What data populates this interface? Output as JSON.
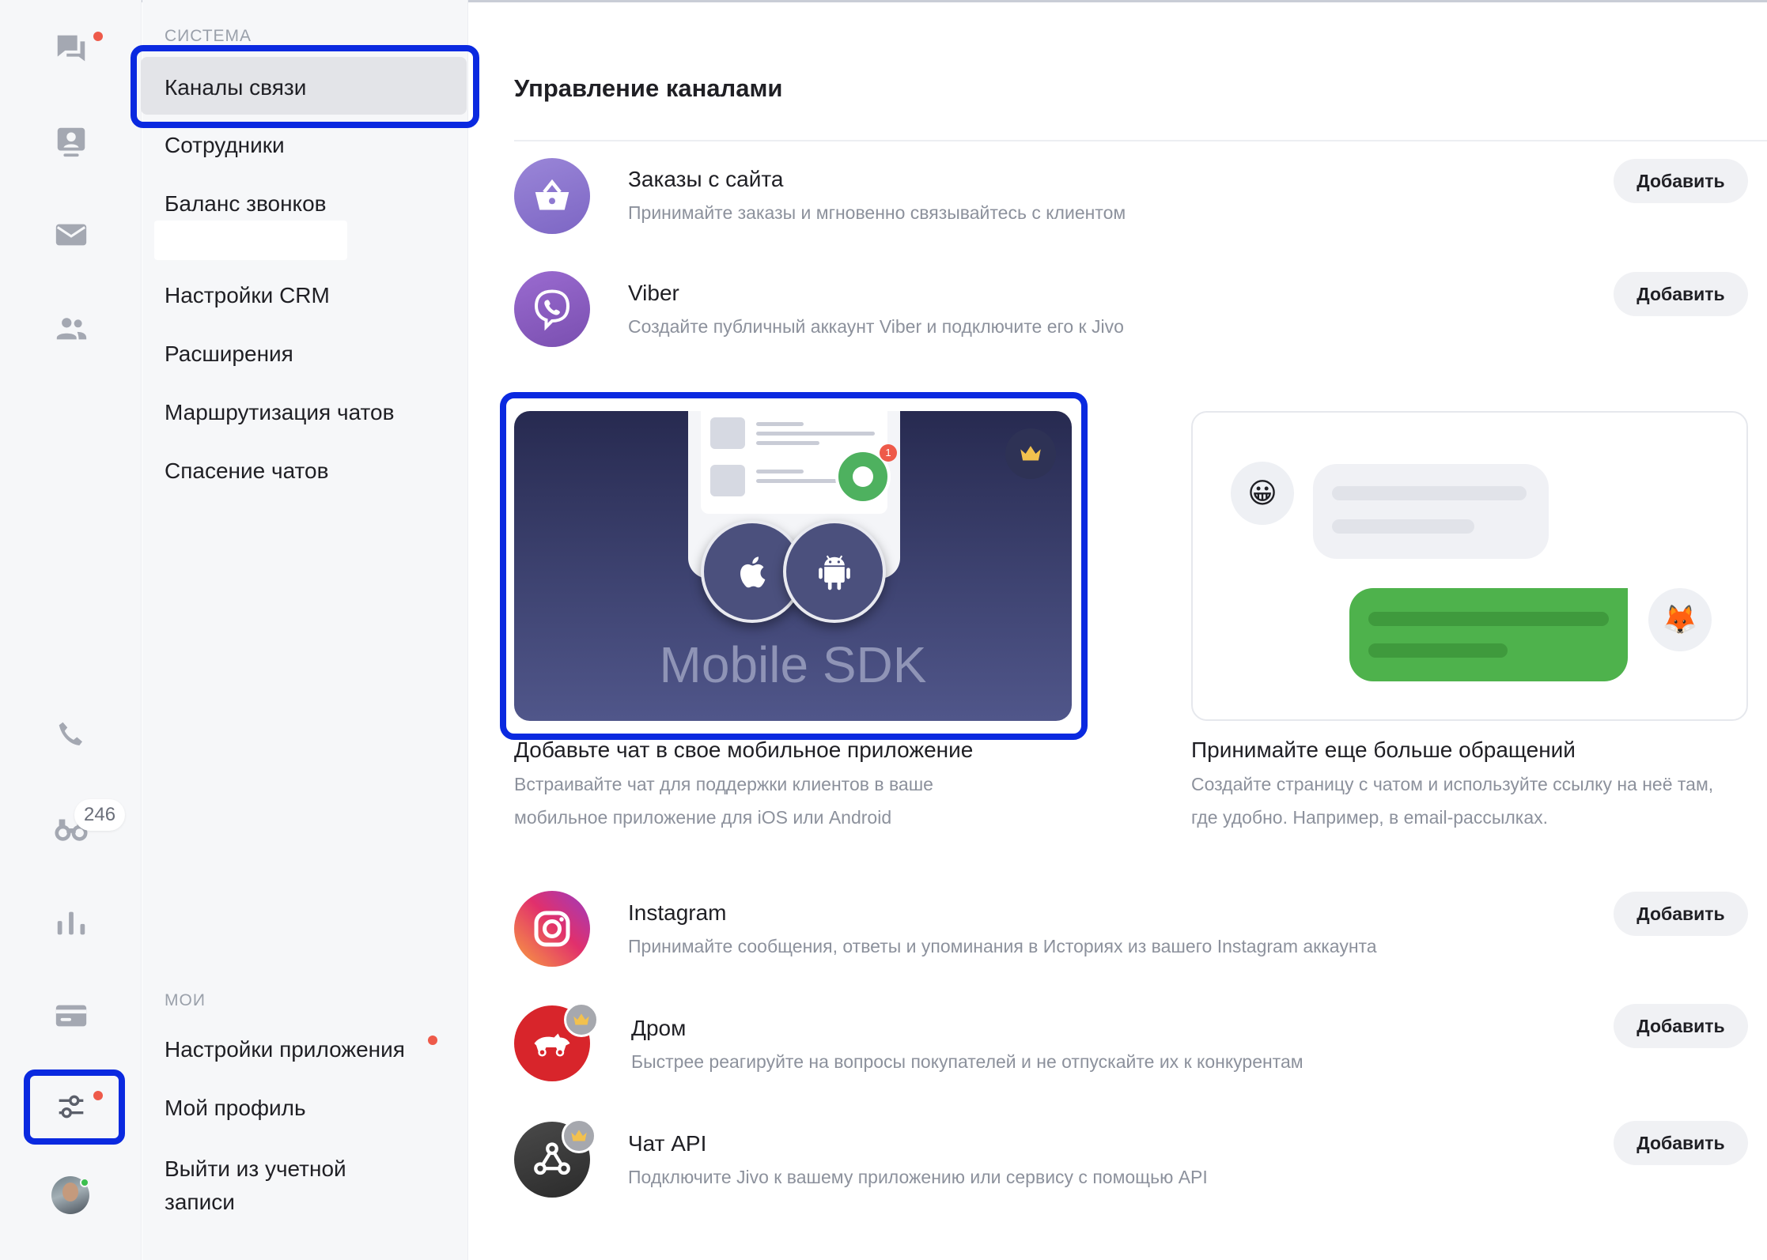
{
  "rail": {
    "badge_count": "246"
  },
  "menu": {
    "section_system": "СИСТЕМА",
    "items_system": [
      "Каналы связи",
      "Сотрудники",
      "Баланс звонков",
      "Настройки CRM",
      "Расширения",
      "Маршрутизация чатов",
      "Спасение чатов"
    ],
    "section_mine": "МОИ",
    "items_mine": [
      "Настройки приложения",
      "Мой профиль",
      "Выйти из учетной записи"
    ]
  },
  "main": {
    "title": "Управление каналами",
    "add_label": "Добавить",
    "channels": [
      {
        "name": "Заказы с сайта",
        "desc": "Принимайте заказы и мгновенно связывайтесь с клиентом",
        "icon": "basket-icon",
        "color": "#8e79d0"
      },
      {
        "name": "Viber",
        "desc": "Создайте публичный аккаунт Viber и подключите его к Jivo",
        "icon": "viber-icon",
        "color": "#8a5cbf"
      },
      {
        "name": "Instagram",
        "desc": "Принимайте сообщения, ответы и упоминания в Историях из вашего Instagram аккаунта",
        "icon": "instagram-icon",
        "color": "#e1306c"
      },
      {
        "name": "Дром",
        "desc": "Быстрее реагируйте на вопросы покупателей и не отпускайте их к конкурентам",
        "icon": "drom-icon",
        "color": "#d8252b"
      },
      {
        "name": "Чат API",
        "desc": "Подключите Jivo к вашему приложению или сервису с помощью API",
        "icon": "webhook-icon",
        "color": "#3c3c3c"
      }
    ],
    "cards": {
      "sdk": {
        "label": "Mobile SDK",
        "notification": "1",
        "title": "Добавьте чат в свое мобильное приложение",
        "desc": "Встраивайте чат для поддержки клиентов в ваше мобильное приложение для iOS или Android"
      },
      "chat_page": {
        "title": "Принимайте еще больше обращений",
        "desc": "Создайте страницу с чатом и используйте ссылку на неё там, где удобно. Например, в email-рассылках.",
        "emoji_left": "😀",
        "emoji_right": "🦊"
      }
    }
  },
  "colors": {
    "highlight": "#0a29e0",
    "notification": "#ee5a4a",
    "online": "#3cbf4e",
    "chat_green": "#4eb24c"
  }
}
